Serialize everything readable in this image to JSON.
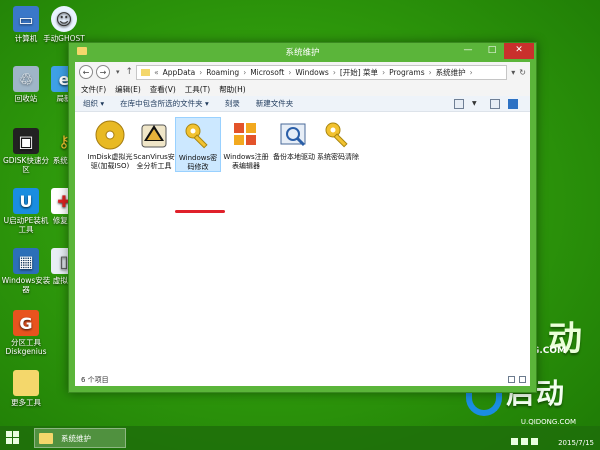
{
  "desktop": {
    "icons": [
      {
        "label": "计算机",
        "icon": "computer-icon"
      },
      {
        "label": "手动GHOST",
        "icon": "ghost-icon"
      },
      {
        "label": "回收站",
        "icon": "recycle-bin-icon"
      },
      {
        "label": "局新",
        "icon": "ie-icon"
      },
      {
        "label": "GDISK快速分区",
        "icon": "gdisk-icon"
      },
      {
        "label": "系统密",
        "icon": "key-icon"
      },
      {
        "label": "U启动PE装机工具",
        "icon": "uqidong-icon"
      },
      {
        "label": "修复系",
        "icon": "repair-icon"
      },
      {
        "label": "Windows安装器",
        "icon": "windows-installer-icon"
      },
      {
        "label": "虚拟光",
        "icon": "virtual-drive-icon"
      },
      {
        "label": "分区工具Diskgenius",
        "icon": "diskgenius-icon"
      },
      {
        "label": "更多工具",
        "icon": "folder-icon"
      }
    ]
  },
  "brand": {
    "top": "动",
    "ong": "ONG.COM",
    "text": "启动",
    "url": "U.QIDONG.COM"
  },
  "window": {
    "title": "系统维护",
    "controls": {
      "minimize": "—",
      "maximize": "□",
      "close": "✕"
    },
    "nav": {
      "back": "←",
      "forward": "→",
      "recent": "▾",
      "up": "↑"
    },
    "address": {
      "prefix": "«",
      "segments": [
        "AppData",
        "Roaming",
        "Microsoft",
        "Windows",
        "[开始] 菜单",
        "Programs",
        "系统维护"
      ],
      "separator": "›",
      "dropdown": "▾",
      "refresh": "↻"
    },
    "menu": [
      "文件(F)",
      "编辑(E)",
      "查看(V)",
      "工具(T)",
      "帮助(H)"
    ],
    "commands": [
      "组织 ▾",
      "在库中包含所选的文件夹 ▾",
      "刻录",
      "新建文件夹"
    ],
    "files": [
      {
        "label": "ImDisk虚拟光驱(加载ISO)",
        "icon": "disc-icon"
      },
      {
        "label": "ScanVirus安全分析工具",
        "icon": "scanvirus-icon"
      },
      {
        "label": "Windows密码修改",
        "icon": "key-icon",
        "selected": true
      },
      {
        "label": "Windows注册表编辑器",
        "icon": "registry-icon"
      },
      {
        "label": "备份本地驱动",
        "icon": "backup-driver-icon"
      },
      {
        "label": "系统密码清除",
        "icon": "key-icon"
      }
    ],
    "status": "6 个项目"
  },
  "taskbar": {
    "item": "系统维护",
    "date": "2015/7/15"
  },
  "colors": {
    "desktop_green": "#2f9a0c",
    "window_frame": "#5bb53a",
    "selection": "#cce8ff",
    "highlight_underline": "#e0202a"
  }
}
